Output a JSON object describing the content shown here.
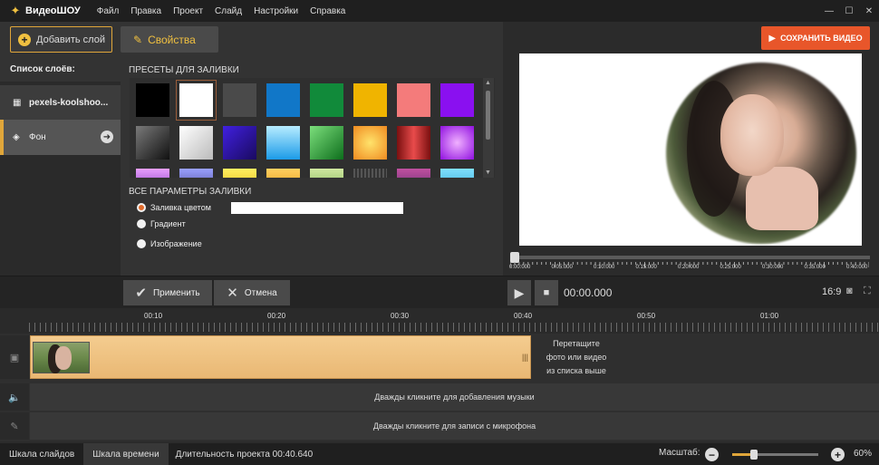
{
  "app": {
    "name": "ВидеоШОУ"
  },
  "menu": [
    "Файл",
    "Правка",
    "Проект",
    "Слайд",
    "Настройки",
    "Справка"
  ],
  "window_controls": {
    "minimize": "—",
    "maximize": "☐",
    "close": "✕"
  },
  "toolbar": {
    "add_layer": "Добавить слой",
    "properties": "Свойства",
    "save_video": "СОХРАНИТЬ ВИДЕО"
  },
  "layers": {
    "title": "Список слоёв:",
    "items": [
      {
        "label": "pexels-koolshoo...",
        "icon": "film-icon"
      },
      {
        "label": "Фон",
        "icon": "paint-bucket-icon"
      }
    ]
  },
  "presets": {
    "title": "ПРЕСЕТЫ ДЛЯ ЗАЛИВКИ",
    "swatches": [
      "#000000",
      "#ffffff",
      "#4a4a4a",
      "#1177c8",
      "#118a3a",
      "#f0b400",
      "#f47b7b",
      "#8a10f0",
      "linear-gradient(135deg,#7a7a7a,#111)",
      "linear-gradient(135deg,#fff,#bbb)",
      "linear-gradient(135deg,#4020e0,#1a0a60)",
      "linear-gradient(180deg,#b7ecff,#1c9be8)",
      "linear-gradient(135deg,#7cdf7c,#0d6e1c)",
      "radial-gradient(circle,#ffe36b,#f08a20)",
      "linear-gradient(90deg,#7a1010,#e84b4b,#7a1010)",
      "radial-gradient(circle,#f0b0ff,#9010e0)",
      "linear-gradient(180deg,#e8a0ff,#6010a0)",
      "linear-gradient(180deg,#9aa0ff,#303070)",
      "linear-gradient(180deg,#fff060,#e0a000)",
      "linear-gradient(180deg,#ffd060,#e08000)",
      "linear-gradient(180deg,#cfe8a0,#6aa040)",
      "repeating-linear-gradient(90deg,#555 0 2px,#333 2px 4px)",
      "linear-gradient(180deg,#c050a0,#402060)",
      "linear-gradient(180deg,#7fe0ff,#2090c0)"
    ]
  },
  "fill": {
    "title": "ВСЕ ПАРАМЕТРЫ ЗАЛИВКИ",
    "options": [
      "Заливка цветом",
      "Градиент",
      "Изображение"
    ],
    "selected": 0,
    "color": "#ffffff"
  },
  "preview": {
    "scrub_ticks": [
      "0:00:000",
      "0:05:000",
      "0:10:000",
      "0:15:000",
      "0:20:000",
      "0:25:000",
      "0:30:000",
      "0:35:000",
      "0:40:000"
    ]
  },
  "controls": {
    "apply": "Применить",
    "cancel": "Отмена",
    "timecode": "00:00.000",
    "ratio": "16:9"
  },
  "timeline": {
    "ruler": [
      "00:10",
      "00:20",
      "00:30",
      "00:40",
      "00:50",
      "01:00"
    ],
    "drop_hint": [
      "Перетащите",
      "фото или видео",
      "из списка выше"
    ],
    "music_hint": "Дважды кликните для добавления музыки",
    "mic_hint": "Дважды кликните для записи с микрофона"
  },
  "status": {
    "tab_slides": "Шкала слайдов",
    "tab_timeline": "Шкала времени",
    "duration": "Длительность проекта 00:40.640",
    "zoom_label": "Масштаб:",
    "zoom": 0.6,
    "zoom_value": "60%"
  },
  "colors": {
    "accent": "#e0a63a",
    "save": "#e8562a",
    "radio": "#e06a2a"
  }
}
